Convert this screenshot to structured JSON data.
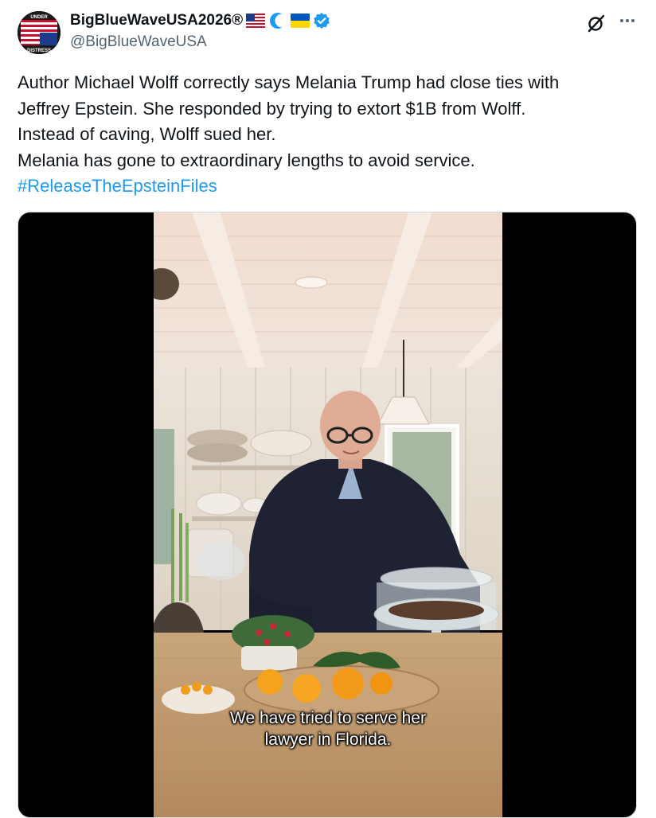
{
  "author": {
    "display_name": "BigBlueWaveUSA2026®",
    "handle": "@BigBlueWaveUSA",
    "avatar_text_top": "UNDER",
    "avatar_text_bottom": "DISTRESS",
    "badges": [
      "us-flag-icon",
      "moon-icon",
      "ukraine-flag-icon",
      "verified-badge-icon"
    ]
  },
  "tweet": {
    "lines": [
      "Author Michael Wolff correctly says Melania Trump had close ties with",
      "Jeffrey Epstein. She responded by trying to extort $1B from Wolff.",
      "Instead of caving, Wolff sued her.",
      "Melania has gone to extraordinary lengths to avoid service."
    ],
    "hashtag": "#ReleaseTheEpsteinFiles"
  },
  "video": {
    "caption_line1": "We have tried to serve her",
    "caption_line2": "lawyer in Florida."
  },
  "colors": {
    "link": "#1d9bf0",
    "secondary": "#536471",
    "verified": "#1d9bf0"
  }
}
